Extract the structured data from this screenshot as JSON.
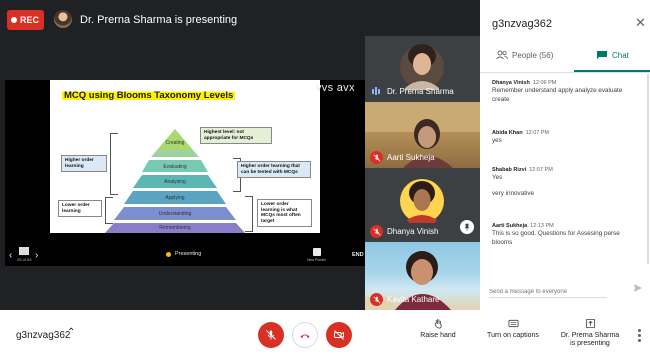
{
  "recording": {
    "label": "REC"
  },
  "presenter_banner": {
    "text": "Dr. Prerna Sharma is presenting"
  },
  "slide": {
    "title": "MCQ using Blooms Taxonomy Levels",
    "levels": [
      "Creating",
      "Evaluating",
      "Analysing",
      "Applying",
      "Understanding",
      "Remembering"
    ],
    "notes": {
      "top_right": "Highest level: not appropriate for MCQs",
      "middle_right": "Higher order learning that can be tested with MCQs",
      "left_top": "Higher order learning",
      "left_bottom": "Lower order learning",
      "bottom_right": "Lower order learning is what MCQs most often target"
    },
    "controls": {
      "page": "25 of 53",
      "presenting_label": "Presenting",
      "new_pointer_label": "New Pointer",
      "end_label": "END"
    },
    "overlay_text": "vvs avx"
  },
  "tiles": [
    {
      "name": "Dr. Prerna Sharma",
      "mic": "on"
    },
    {
      "name": "Aarti Sukheja",
      "mic": "off"
    },
    {
      "name": "Dhanya Vinish",
      "mic": "off"
    },
    {
      "name": "Kavita Kathare",
      "mic": "off"
    }
  ],
  "panel": {
    "title": "g3nzvag362",
    "tabs": {
      "people": "People (56)",
      "chat": "Chat"
    },
    "messages": [
      {
        "name": "Dhanya Vinish",
        "time": "12:06 PM",
        "lines": [
          "Remember understand apply analyze evaluate",
          "create"
        ]
      },
      {
        "name": "Abida Khan",
        "time": "12:07 PM",
        "lines": [
          "yes"
        ]
      },
      {
        "name": "Shabab Rizvi",
        "time": "12:07 PM",
        "lines": [
          "Yes",
          "very innovative"
        ]
      },
      {
        "name": "Aarti Sukheja",
        "time": "12:13 PM",
        "lines": [
          "This is so good. Questions for Assesing perse",
          "blooms"
        ]
      }
    ],
    "input_placeholder": "Send a message to everyone"
  },
  "bottom": {
    "meeting_code": "g3nzvag362",
    "raise_hand": "Raise hand",
    "captions": "Turn on captions",
    "presenting_line1": "Dr. Prerna Sharma",
    "presenting_line2": "is presenting"
  },
  "colors": {
    "danger": "#d93025",
    "accent": "#00796b",
    "stage_bg": "#202124"
  }
}
